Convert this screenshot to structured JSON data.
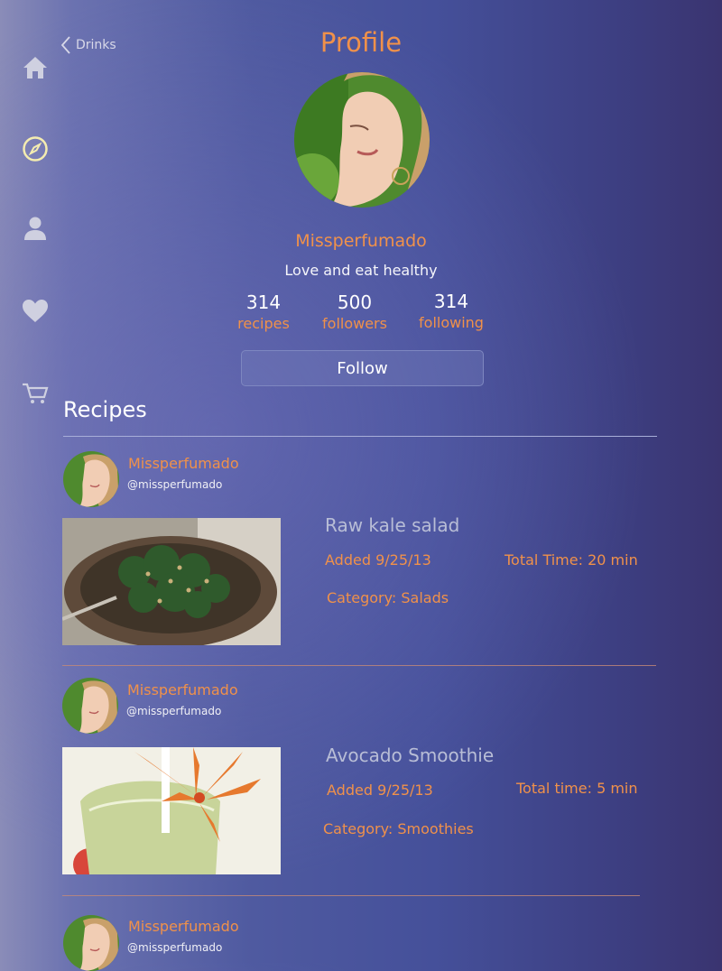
{
  "header": {
    "back_label": "Drinks",
    "title": "Profile"
  },
  "sidebar": {
    "items": [
      {
        "icon": "home-icon"
      },
      {
        "icon": "compass-icon"
      },
      {
        "icon": "user-icon"
      },
      {
        "icon": "heart-icon"
      },
      {
        "icon": "cart-icon"
      }
    ]
  },
  "profile": {
    "name": "Missperfumado",
    "bio": "Love and eat healthy",
    "stats": [
      {
        "value": "314",
        "label": "recipes"
      },
      {
        "value": "500",
        "label": "followers"
      },
      {
        "value": "314",
        "label": "following"
      }
    ],
    "follow_label": "Follow"
  },
  "recipes": {
    "section_title": "Recipes",
    "items": [
      {
        "author": "Missperfumado",
        "handle": "@missperfumado",
        "title": "Raw kale salad",
        "added": "Added 9/25/13",
        "total_time": "Total Time: 20 min",
        "category": "Category: Salads"
      },
      {
        "author": "Missperfumado",
        "handle": "@missperfumado",
        "title": "Avocado Smoothie",
        "added": "Added 9/25/13",
        "total_time": "Total time: 5 min",
        "category": "Category: Smoothies"
      },
      {
        "author": "Missperfumado",
        "handle": "@missperfumado"
      }
    ]
  },
  "colors": {
    "accent": "#f0914a",
    "background": "#45509a"
  }
}
